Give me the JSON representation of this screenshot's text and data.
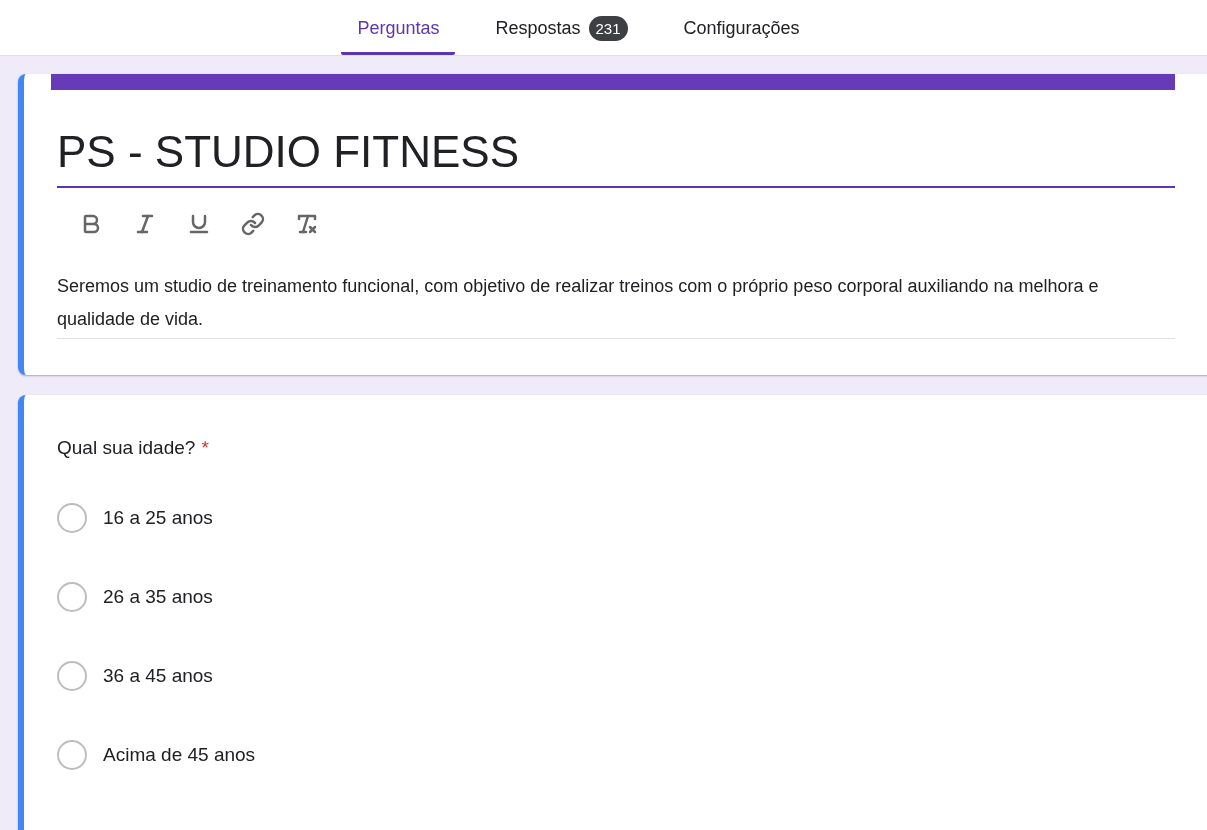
{
  "tabs": [
    {
      "label": "Perguntas",
      "selected": true
    },
    {
      "label": "Respostas",
      "selected": false,
      "badge": "231"
    },
    {
      "label": "Configurações",
      "selected": false
    }
  ],
  "form": {
    "title": "PS - STUDIO FITNESS",
    "description": "Seremos um studio de treinamento funcional, com objetivo de realizar treinos com o próprio peso corporal auxiliando na melhora e qualidade de vida."
  },
  "question": {
    "text": "Qual sua idade?",
    "required": true,
    "required_mark": "*",
    "options": [
      {
        "label": "16 a 25 anos",
        "selected": false
      },
      {
        "label": "26 a 35 anos",
        "selected": false
      },
      {
        "label": "36 a 45 anos",
        "selected": false
      },
      {
        "label": "Acima de 45 anos",
        "selected": false
      }
    ]
  }
}
